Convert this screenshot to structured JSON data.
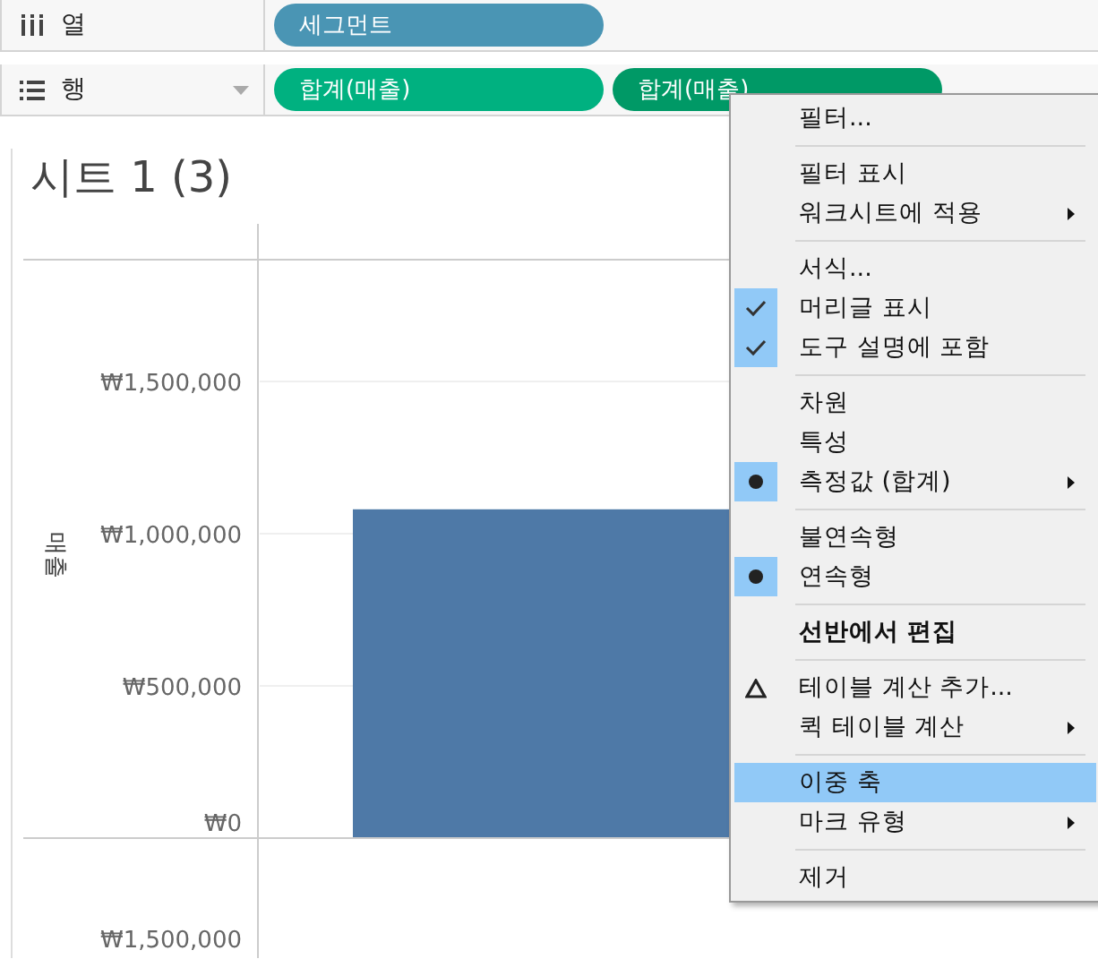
{
  "shelves": [
    {
      "kind": "columns",
      "label": "열",
      "pills": [
        {
          "label": "세그먼트",
          "color": "#4a95b4"
        }
      ]
    },
    {
      "kind": "rows",
      "label": "행",
      "pills": [
        {
          "label": "합계(매출)",
          "color": "#00b180"
        },
        {
          "label": "합계(매출)",
          "color": "#009966"
        }
      ]
    }
  ],
  "sheet": {
    "title": "시트 1 (3)",
    "chart_data": {
      "type": "bar",
      "ylabel": "매출",
      "grid": true,
      "ylim": [
        0,
        1900000
      ],
      "yticks": [
        {
          "value": 0,
          "label": "₩0"
        },
        {
          "value": 500000,
          "label": "₩500,000"
        },
        {
          "value": 1000000,
          "label": "₩1,000,000"
        },
        {
          "value": 1500000,
          "label": "₩1,500,000"
        }
      ],
      "series": [
        {
          "color": "#4e79a7",
          "values": [
            1080000
          ]
        }
      ]
    },
    "lower_pane_tick": "₩1,500,000"
  },
  "context_menu": {
    "items": [
      {
        "kind": "command",
        "label": "필터...",
        "submenu": false,
        "bold": false,
        "selected": false
      },
      {
        "kind": "separator"
      },
      {
        "kind": "command",
        "label": "필터 표시",
        "submenu": false,
        "bold": false,
        "selected": false
      },
      {
        "kind": "command",
        "label": "워크시트에 적용",
        "submenu": true,
        "bold": false,
        "selected": false
      },
      {
        "kind": "separator"
      },
      {
        "kind": "command",
        "label": "서식...",
        "submenu": false,
        "bold": false,
        "selected": false
      },
      {
        "kind": "check",
        "label": "머리글 표시",
        "checked": true,
        "submenu": false,
        "bold": false,
        "selected": false
      },
      {
        "kind": "check",
        "label": "도구 설명에 포함",
        "checked": true,
        "submenu": false,
        "bold": false,
        "selected": false
      },
      {
        "kind": "separator"
      },
      {
        "kind": "radio",
        "label": "차원",
        "checked": false,
        "submenu": false,
        "bold": false,
        "selected": false
      },
      {
        "kind": "radio",
        "label": "특성",
        "checked": false,
        "submenu": false,
        "bold": false,
        "selected": false
      },
      {
        "kind": "radio",
        "label": "측정값 (합계)",
        "checked": true,
        "submenu": true,
        "bold": false,
        "selected": false
      },
      {
        "kind": "separator"
      },
      {
        "kind": "radio",
        "label": "불연속형",
        "checked": false,
        "submenu": false,
        "bold": false,
        "selected": false
      },
      {
        "kind": "radio",
        "label": "연속형",
        "checked": true,
        "submenu": false,
        "bold": false,
        "selected": false
      },
      {
        "kind": "separator"
      },
      {
        "kind": "command",
        "label": "선반에서 편집",
        "submenu": false,
        "bold": true,
        "selected": false
      },
      {
        "kind": "separator"
      },
      {
        "kind": "table_calc",
        "label": "테이블 계산 추가...",
        "submenu": false,
        "bold": false,
        "selected": false
      },
      {
        "kind": "command",
        "label": "퀵 테이블 계산",
        "submenu": true,
        "bold": false,
        "selected": false
      },
      {
        "kind": "separator"
      },
      {
        "kind": "command",
        "label": "이중 축",
        "submenu": false,
        "bold": false,
        "selected": true
      },
      {
        "kind": "command",
        "label": "마크 유형",
        "submenu": true,
        "bold": false,
        "selected": false
      },
      {
        "kind": "separator"
      },
      {
        "kind": "command",
        "label": "제거",
        "submenu": false,
        "bold": false,
        "selected": false
      }
    ]
  }
}
